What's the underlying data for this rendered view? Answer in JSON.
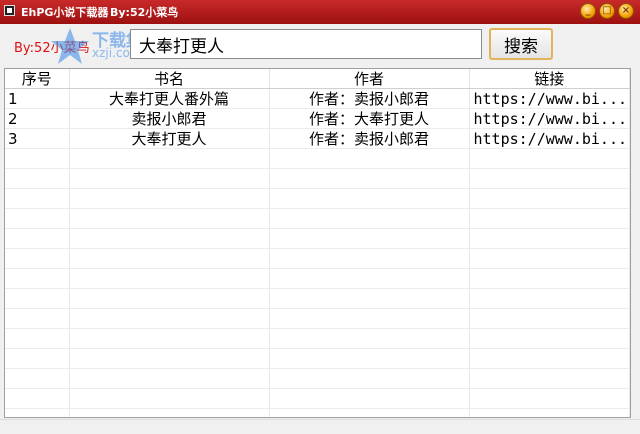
{
  "window": {
    "title": "EhPG小说下载器",
    "title_author": "By:52小菜鸟",
    "controls": {
      "minimize": "_",
      "maximize": "□",
      "close": "×"
    }
  },
  "toolbar": {
    "credit": "By:52小菜鸟",
    "search_value": "大奉打更人",
    "search_button": "搜索"
  },
  "watermark": {
    "cn": "下载集",
    "en": "xzji.com"
  },
  "table": {
    "headers": [
      "序号",
      "书名",
      "作者",
      "链接"
    ],
    "rows": [
      {
        "index": "1",
        "name": "大奉打更人番外篇",
        "author": "作者：卖报小郎君",
        "link": "https://www.bi..."
      },
      {
        "index": "2",
        "name": "卖报小郎君",
        "author": "作者：大奉打更人",
        "link": "https://www.bi..."
      },
      {
        "index": "3",
        "name": "大奉打更人",
        "author": "作者：卖报小郎君",
        "link": "https://www.bi..."
      }
    ],
    "empty_rows": 14
  },
  "colors": {
    "titlebar": "#b51a1a",
    "credit": "#dd1111",
    "button_border": "#e3b35c"
  }
}
